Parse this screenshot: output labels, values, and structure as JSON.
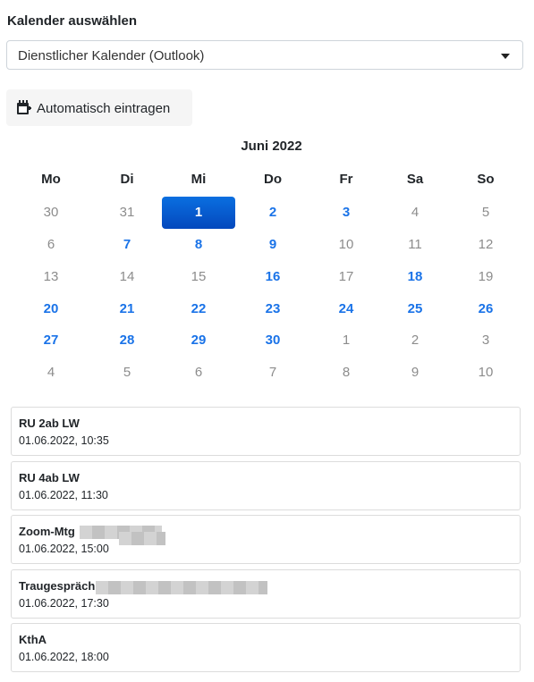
{
  "calendar_select": {
    "label": "Kalender auswählen",
    "value": "Dienstlicher Kalender (Outlook)"
  },
  "auto_button": {
    "label": "Automatisch eintragen",
    "icon": "calendar-plus-icon"
  },
  "month_title": "Juni 2022",
  "weekdays": [
    "Mo",
    "Di",
    "Mi",
    "Do",
    "Fr",
    "Sa",
    "So"
  ],
  "weeks": [
    [
      {
        "label": "30",
        "state": "muted"
      },
      {
        "label": "31",
        "state": "muted"
      },
      {
        "label": "1",
        "state": "selected"
      },
      {
        "label": "2",
        "state": "event"
      },
      {
        "label": "3",
        "state": "event"
      },
      {
        "label": "4",
        "state": "muted"
      },
      {
        "label": "5",
        "state": "muted"
      }
    ],
    [
      {
        "label": "6",
        "state": "muted"
      },
      {
        "label": "7",
        "state": "event"
      },
      {
        "label": "8",
        "state": "event"
      },
      {
        "label": "9",
        "state": "event"
      },
      {
        "label": "10",
        "state": "muted"
      },
      {
        "label": "11",
        "state": "muted"
      },
      {
        "label": "12",
        "state": "muted"
      }
    ],
    [
      {
        "label": "13",
        "state": "muted"
      },
      {
        "label": "14",
        "state": "muted"
      },
      {
        "label": "15",
        "state": "muted"
      },
      {
        "label": "16",
        "state": "event"
      },
      {
        "label": "17",
        "state": "muted"
      },
      {
        "label": "18",
        "state": "event"
      },
      {
        "label": "19",
        "state": "muted"
      }
    ],
    [
      {
        "label": "20",
        "state": "event"
      },
      {
        "label": "21",
        "state": "event"
      },
      {
        "label": "22",
        "state": "event"
      },
      {
        "label": "23",
        "state": "event"
      },
      {
        "label": "24",
        "state": "event"
      },
      {
        "label": "25",
        "state": "event"
      },
      {
        "label": "26",
        "state": "event"
      }
    ],
    [
      {
        "label": "27",
        "state": "event"
      },
      {
        "label": "28",
        "state": "event"
      },
      {
        "label": "29",
        "state": "event"
      },
      {
        "label": "30",
        "state": "event"
      },
      {
        "label": "1",
        "state": "muted"
      },
      {
        "label": "2",
        "state": "muted"
      },
      {
        "label": "3",
        "state": "muted"
      }
    ],
    [
      {
        "label": "4",
        "state": "muted"
      },
      {
        "label": "5",
        "state": "muted"
      },
      {
        "label": "6",
        "state": "muted"
      },
      {
        "label": "7",
        "state": "muted"
      },
      {
        "label": "8",
        "state": "muted"
      },
      {
        "label": "9",
        "state": "muted"
      },
      {
        "label": "10",
        "state": "muted"
      }
    ]
  ],
  "events": [
    {
      "title": "RU 2ab LW",
      "time": "01.06.2022, 10:35"
    },
    {
      "title": "RU 4ab LW",
      "time": "01.06.2022, 11:30"
    },
    {
      "title": "Zoom-Mtg",
      "time": "01.06.2022, 15:00"
    },
    {
      "title": "Traugespräch",
      "time": "01.06.2022, 17:30"
    },
    {
      "title": "KthA",
      "time": "01.06.2022, 18:00"
    }
  ],
  "colors": {
    "accent": "#1a73e8",
    "selected_top": "#0a6fe0",
    "selected_bottom": "#0448bd",
    "muted": "#8c8c8c"
  }
}
